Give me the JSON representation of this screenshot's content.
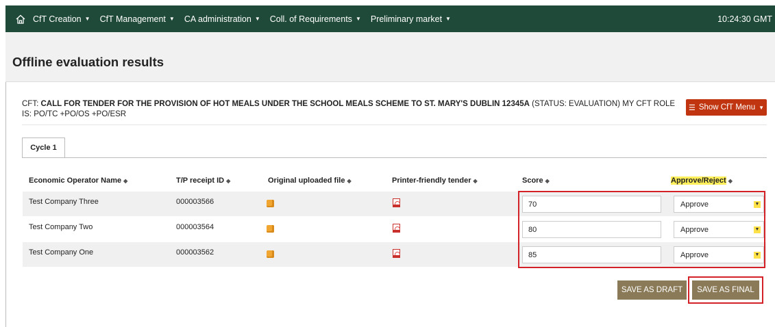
{
  "nav": {
    "home_icon": "home-icon",
    "items": [
      {
        "label": "CfT Creation"
      },
      {
        "label": "CfT Management"
      },
      {
        "label": "CA administration"
      },
      {
        "label": "Coll. of Requirements"
      },
      {
        "label": "Preliminary market"
      }
    ],
    "clock": "10:24:30 GMT"
  },
  "page": {
    "title": "Offline evaluation results"
  },
  "cft": {
    "prefix": "CfT: ",
    "name": "CALL FOR TENDER FOR THE PROVISION OF HOT MEALS UNDER THE SCHOOL MEALS SCHEME TO ST. MARY'S DUBLIN 12345A",
    "status": " (STATUS: EVALUATION) MY CFT ROLE IS: PO/TC +PO/OS +PO/ESR",
    "menu_button": "Show CfT Menu"
  },
  "tabs": [
    {
      "label": "Cycle 1",
      "active": true
    }
  ],
  "table": {
    "headers": {
      "operator": "Economic Operator Name",
      "receipt": "T/P receipt ID",
      "original": "Original uploaded file",
      "printer": "Printer-friendly tender",
      "score": "Score",
      "approve": "Approve/Reject"
    },
    "rows": [
      {
        "operator": "Test Company Three",
        "receipt": "000003566",
        "score": "70",
        "decision": "Approve"
      },
      {
        "operator": "Test Company Two",
        "receipt": "000003564",
        "score": "80",
        "decision": "Approve"
      },
      {
        "operator": "Test Company One",
        "receipt": "000003562",
        "score": "85",
        "decision": "Approve"
      }
    ]
  },
  "actions": {
    "save_draft": "SAVE AS DRAFT",
    "save_final": "SAVE AS FINAL"
  },
  "colors": {
    "topbar": "#1f4a39",
    "menu_button": "#c0350f",
    "action_button": "#8a7a57",
    "highlight_box": "#d42127",
    "highlight_text": "#ffef5a"
  }
}
